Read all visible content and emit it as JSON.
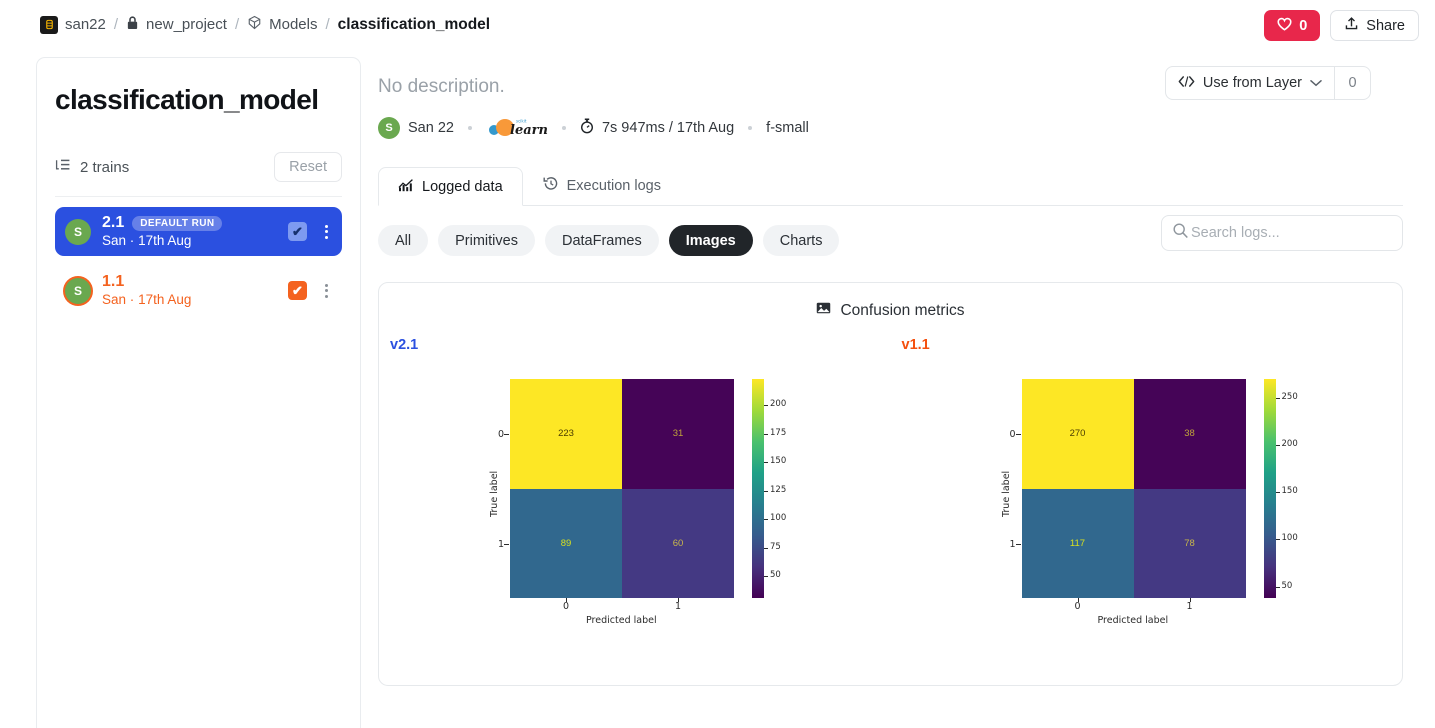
{
  "topbar": {
    "breadcrumb": [
      {
        "label": "san22",
        "icon": "org-icon"
      },
      {
        "label": "new_project",
        "icon": "lock-icon"
      },
      {
        "label": "Models",
        "icon": "cube-icon"
      },
      {
        "label": "classification_model",
        "icon": ""
      }
    ],
    "separator": "/",
    "like_count": "0",
    "like_icon": "heart-icon",
    "share_label": "Share",
    "share_icon": "share-icon"
  },
  "sidebar": {
    "title": "classification_model",
    "trains_label": "2 trains",
    "trains_icon": "tree-list-icon",
    "reset_label": "Reset",
    "runs": [
      {
        "version": "2.1",
        "badge": "DEFAULT RUN",
        "author": "San",
        "separator": "·",
        "date": "17th Aug",
        "avatar_initial": "S",
        "checked": true,
        "selected": true
      },
      {
        "version": "1.1",
        "badge": "",
        "author": "San",
        "separator": "·",
        "date": "17th Aug",
        "avatar_initial": "S",
        "checked": true,
        "selected": false
      }
    ]
  },
  "main": {
    "description": "No description.",
    "meta": {
      "author_initial": "S",
      "author": "San 22",
      "framework": "scikit-learn",
      "duration_icon": "stopwatch-icon",
      "duration": "7s 947ms / 17th Aug",
      "instance": "f-small"
    },
    "layer_button": {
      "icon": "code-icon",
      "label": "Use from Layer",
      "chevron": "chevron-down-icon",
      "count": "0"
    },
    "tabs": [
      {
        "label": "Logged data",
        "icon": "chart-icon",
        "active": true
      },
      {
        "label": "Execution logs",
        "icon": "history-icon",
        "active": false
      }
    ],
    "filters": [
      {
        "label": "All",
        "active": false
      },
      {
        "label": "Primitives",
        "active": false
      },
      {
        "label": "DataFrames",
        "active": false
      },
      {
        "label": "Images",
        "active": true
      },
      {
        "label": "Charts",
        "active": false
      }
    ],
    "search": {
      "placeholder": "Search logs...",
      "value": "",
      "icon": "search-icon"
    },
    "log_card": {
      "title": "Confusion metrics",
      "title_icon": "image-icon",
      "panel_labels": [
        "v2.1",
        "v1.1"
      ]
    }
  },
  "colors": {
    "accent_blue": "#2b50e0",
    "accent_orange": "#f4621f",
    "like_red": "#e8274b",
    "pill_active": "#212529",
    "viridis_yellow": "#fde725",
    "viridis_dark": "#440154",
    "viridis_blue": "#31688e",
    "viridis_purple": "#443983"
  },
  "chart_data": [
    {
      "type": "heatmap",
      "title": "v2.1",
      "xlabel": "Predicted label",
      "ylabel": "True label",
      "xticklabels": [
        "0",
        "1"
      ],
      "yticklabels": [
        "0",
        "1"
      ],
      "values": [
        [
          223,
          31
        ],
        [
          89,
          60
        ]
      ],
      "cell_colors": [
        [
          "#fde725",
          "#450457"
        ],
        [
          "#31688e",
          "#443983"
        ]
      ],
      "text_colors": [
        [
          "#4b3d00",
          "#bfa43a"
        ],
        [
          "#d7e020",
          "#c9b84a"
        ]
      ],
      "colorbar": {
        "ticks": [
          50,
          75,
          100,
          125,
          150,
          175,
          200
        ],
        "vmin": 31,
        "vmax": 223,
        "position": "right"
      },
      "colormap": "viridis",
      "grid": false
    },
    {
      "type": "heatmap",
      "title": "v1.1",
      "xlabel": "Predicted label",
      "ylabel": "True label",
      "xticklabels": [
        "0",
        "1"
      ],
      "yticklabels": [
        "0",
        "1"
      ],
      "values": [
        [
          270,
          38
        ],
        [
          117,
          78
        ]
      ],
      "cell_colors": [
        [
          "#fde725",
          "#450457"
        ],
        [
          "#31688e",
          "#443983"
        ]
      ],
      "text_colors": [
        [
          "#4b3d00",
          "#bfa43a"
        ],
        [
          "#d7e020",
          "#c9b84a"
        ]
      ],
      "colorbar": {
        "ticks": [
          50,
          100,
          150,
          200,
          250
        ],
        "vmin": 38,
        "vmax": 270,
        "position": "right"
      },
      "colormap": "viridis",
      "grid": false
    }
  ]
}
